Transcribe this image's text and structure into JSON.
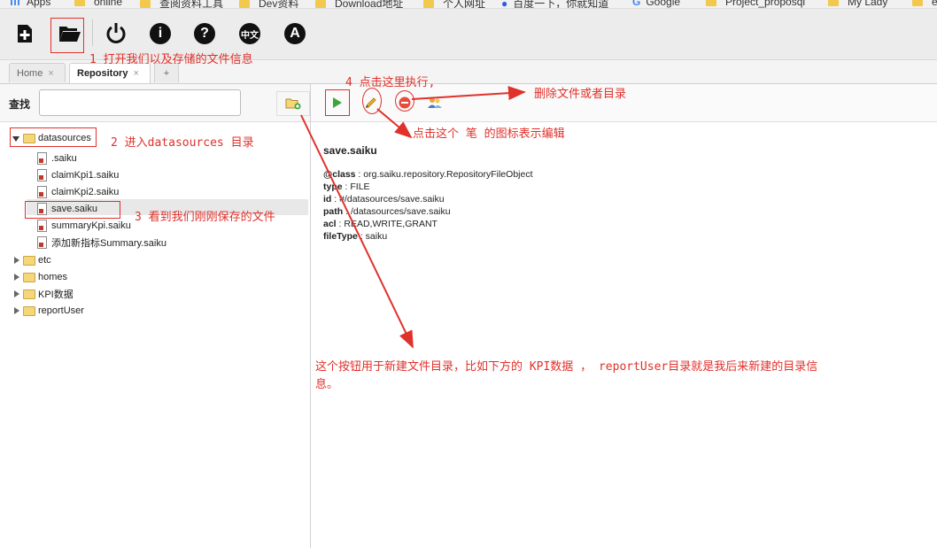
{
  "bookmarks": [
    {
      "label": "Apps",
      "icon": "apps-grid-icon"
    },
    {
      "label": "online",
      "icon": "folder-icon"
    },
    {
      "label": "查阅资料工具",
      "icon": "folder-icon"
    },
    {
      "label": "Dev资料",
      "icon": "folder-icon"
    },
    {
      "label": "Download地址",
      "icon": "folder-icon"
    },
    {
      "label": "个人网址",
      "icon": "folder-icon"
    },
    {
      "label": "百度一下，你就知道",
      "icon": "baidu-icon"
    },
    {
      "label": "Google",
      "icon": "google-icon"
    },
    {
      "label": "Project_proposql",
      "icon": "folder-icon"
    },
    {
      "label": "My Lady",
      "icon": "folder-icon"
    },
    {
      "label": "ef",
      "icon": "folder-icon"
    }
  ],
  "toolbar": {
    "buttons": [
      "new-query-icon",
      "open-folder-icon",
      "power-icon",
      "info-icon",
      "help-icon",
      "language-icon",
      "about-icon"
    ],
    "language_badge": "中文"
  },
  "tabs": [
    {
      "label": "Home",
      "close": "×"
    },
    {
      "label": "Repository",
      "close": "×",
      "active": true
    },
    {
      "label": "+"
    }
  ],
  "search": {
    "label": "查找",
    "placeholder": ""
  },
  "tree": {
    "root": "datasources",
    "files": [
      ".saiku",
      "claimKpi1.saiku",
      "claimKpi2.saiku",
      "save.saiku",
      "summaryKpi.saiku",
      "添加新指标Summary.saiku"
    ],
    "folders": [
      "etc",
      "homes",
      "KPI数据",
      "reportUser"
    ]
  },
  "details": {
    "title": "save.saiku",
    "props": [
      {
        "key": "@class",
        "value": "org.saiku.repository.RepositoryFileObject"
      },
      {
        "key": "type",
        "value": "FILE"
      },
      {
        "key": "id",
        "value": "#/datasources/save.saiku"
      },
      {
        "key": "path",
        "value": "/datasources/save.saiku"
      },
      {
        "key": "acl",
        "value": "READ,WRITE,GRANT"
      },
      {
        "key": "fileType",
        "value": "saiku"
      }
    ]
  },
  "annotations": {
    "a1": "1 打开我们以及存储的文件信息",
    "a2": "2  进入datasources 目录",
    "a3": "3 看到我们刚刚保存的文件",
    "a4": "4 点击这里执行,",
    "delete": "删除文件或者目录",
    "edit": "点击这个 笔 的图标表示编辑",
    "newdir_line1": "这个按钮用于新建文件目录，比如下方的 KPI数据 ， reportUser目录就是我后来新建的目录信",
    "newdir_line2": "息。"
  },
  "colors": {
    "annotation": "#e0312b",
    "toolbar_bg": "#ececec",
    "play": "#3aa63a"
  }
}
